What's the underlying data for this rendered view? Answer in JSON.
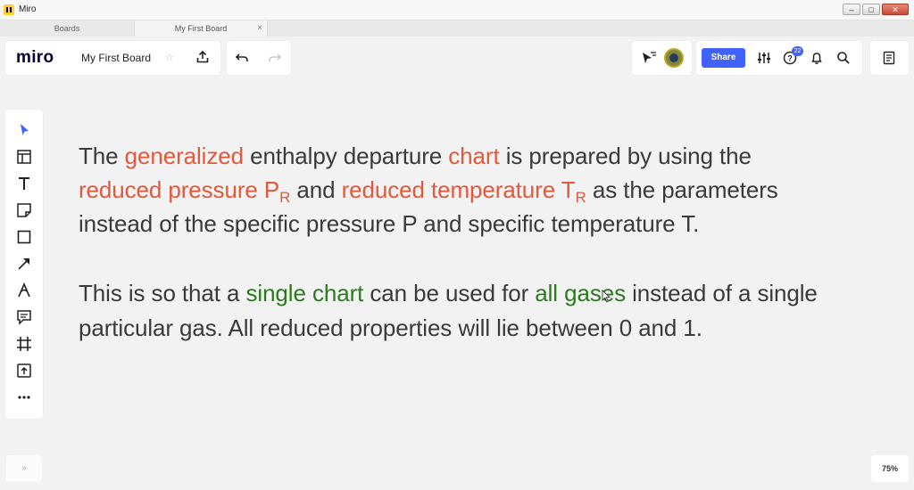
{
  "window": {
    "title": "Miro",
    "minimize": "–",
    "maximize": "□",
    "close": "✕"
  },
  "tabs": [
    {
      "label": "Boards",
      "close": ""
    },
    {
      "label": "My First Board",
      "close": "×"
    }
  ],
  "header": {
    "logo": "miro",
    "board_name": "My First Board",
    "star": "☆"
  },
  "toolbar": {
    "share_label": "Share",
    "notification_count": "22"
  },
  "canvas": {
    "para1": {
      "line1": [
        "The ",
        "generalized",
        " enthalpy departure ",
        "chart",
        " is prepared by using the"
      ],
      "line2": [
        "reduced pressure P",
        "R",
        " and ",
        "reduced temperature T",
        "R",
        " as the parameters"
      ],
      "line3": "instead of the specific pressure P and specific temperature T."
    },
    "para2": {
      "line1": [
        "This is so that a ",
        "single chart",
        " can be used for ",
        "all",
        " ",
        "gases",
        " instead of a single"
      ],
      "line2": "particular gas. All reduced properties will lie between 0 and 1."
    }
  },
  "footer": {
    "zoom": "75%",
    "expand": "»"
  },
  "colors": {
    "accent": "#4262ff",
    "highlight_red": "#e5573b",
    "highlight_green": "#2b7a1f"
  }
}
